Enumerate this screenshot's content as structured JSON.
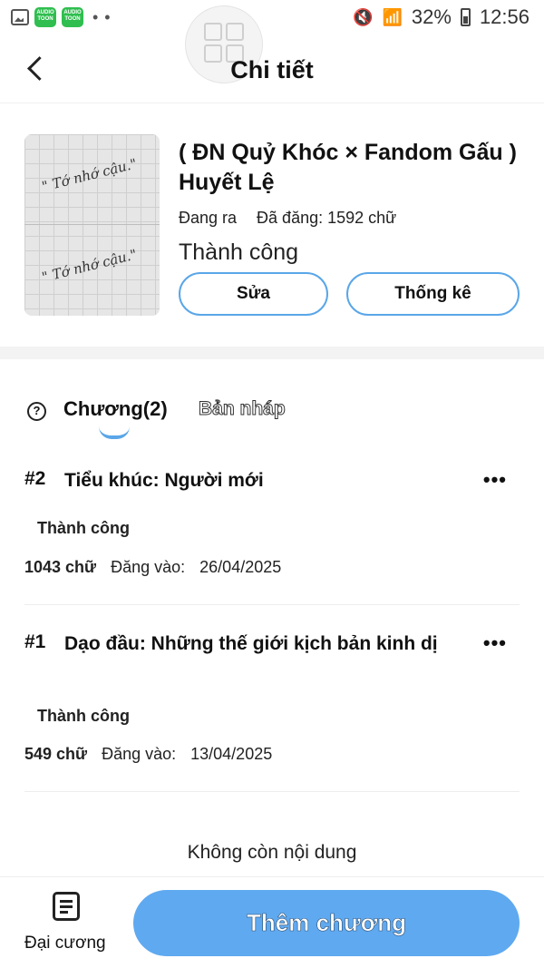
{
  "status_bar": {
    "app_badge_1": "AUDIO TOON",
    "app_badge_2": "AUDIO TOON",
    "dots": "• •",
    "battery_percent": "32%",
    "time": "12:56"
  },
  "header": {
    "title": "Chi tiết"
  },
  "book": {
    "title": "( ĐN Quỷ Khóc × Fandom Gấu ) Huyết Lệ",
    "state": "Đang ra",
    "published_words": "Đã đăng: 1592 chữ",
    "status": "Thành công",
    "cover_text": "\" Tớ nhớ cậu.\"",
    "edit_label": "Sửa",
    "stats_label": "Thống kê"
  },
  "tabs": {
    "help_glyph": "?",
    "chapters_label": "Chương(2)",
    "drafts_label": "Bản nháp"
  },
  "chapters": [
    {
      "number": "#2",
      "title": "Tiểu khúc: Người mới",
      "status": "Thành công",
      "words": "1043 chữ",
      "posted_label": "Đăng vào:",
      "date": "26/04/2025",
      "more": "•••"
    },
    {
      "number": "#1",
      "title": "Dạo đầu: Những thế giới kịch bản kinh dị",
      "status": "Thành công",
      "words": "549 chữ",
      "posted_label": "Đăng vào:",
      "date": "13/04/2025",
      "more": "•••"
    }
  ],
  "end_note": "Không còn nội dung",
  "bottom_bar": {
    "outline_label": "Đại cương",
    "add_chapter_label": "Thêm chương"
  },
  "colors": {
    "accent": "#5aa6e8",
    "primary_button": "#5fa9f0"
  }
}
